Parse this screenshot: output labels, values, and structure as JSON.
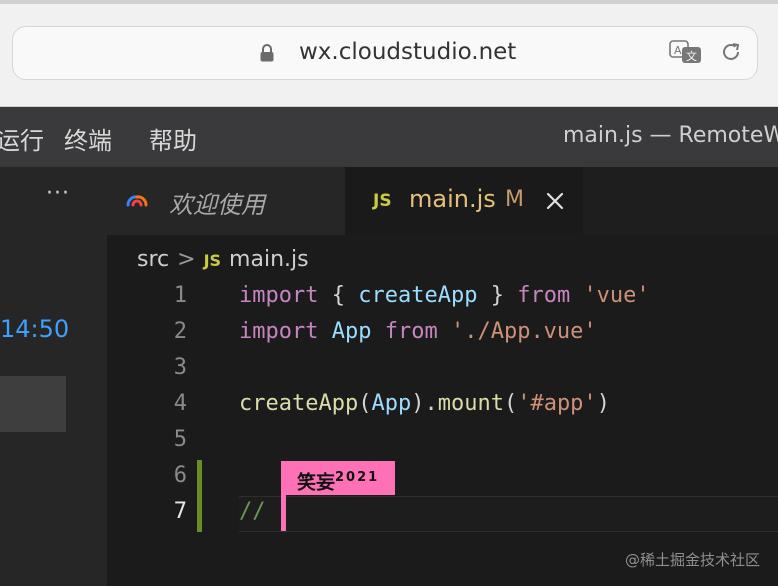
{
  "browser": {
    "url": "wx.cloudstudio.net",
    "icons": {
      "lock": "lock-icon",
      "translate": "translate-icon",
      "reload": "reload-icon"
    }
  },
  "menubar": {
    "items": [
      "运行",
      "终端",
      "帮助"
    ],
    "title": "main.js — RemoteW"
  },
  "sidebar": {
    "more": "···",
    "time": "14:50"
  },
  "tabs": [
    {
      "label": "欢迎使用",
      "icon": "cloudstudio-logo-icon"
    },
    {
      "badge": "JS",
      "label": "main.js",
      "modified": "M",
      "close_icon": "close-icon"
    }
  ],
  "editor": {
    "breadcrumb": {
      "folder": "src",
      "badge": "JS",
      "file": "main.js"
    },
    "line_numbers": [
      "1",
      "2",
      "3",
      "4",
      "5",
      "6",
      "7"
    ],
    "lines": [
      [
        {
          "t": "kw",
          "v": "import"
        },
        {
          "t": "pun",
          "v": " { "
        },
        {
          "t": "ident",
          "v": "createApp"
        },
        {
          "t": "pun",
          "v": " } "
        },
        {
          "t": "kw",
          "v": "from"
        },
        {
          "t": "pun",
          "v": " "
        },
        {
          "t": "str",
          "v": "'vue'"
        }
      ],
      [
        {
          "t": "kw",
          "v": "import"
        },
        {
          "t": "pun",
          "v": " "
        },
        {
          "t": "ident",
          "v": "App"
        },
        {
          "t": "pun",
          "v": " "
        },
        {
          "t": "kw",
          "v": "from"
        },
        {
          "t": "pun",
          "v": " "
        },
        {
          "t": "str",
          "v": "'./App.vue'"
        }
      ],
      [],
      [
        {
          "t": "fn",
          "v": "createApp"
        },
        {
          "t": "pun",
          "v": "("
        },
        {
          "t": "ident",
          "v": "App"
        },
        {
          "t": "pun",
          "v": ")."
        },
        {
          "t": "fn",
          "v": "mount"
        },
        {
          "t": "pun",
          "v": "("
        },
        {
          "t": "str",
          "v": "'#app'"
        },
        {
          "t": "pun",
          "v": ")"
        }
      ],
      [],
      [],
      [
        {
          "t": "comment",
          "v": "//"
        }
      ]
    ],
    "collaborator": {
      "name": "笑妄",
      "year": "2021"
    }
  },
  "watermark": "@稀土掘金技术社区",
  "colors": {
    "accent_js": "#cbcb41",
    "collaborator": "#ff71b6",
    "time": "#3ea0ff",
    "gutter_modified": "#6b8e23"
  }
}
